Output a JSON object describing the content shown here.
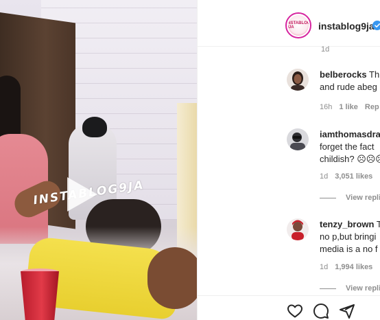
{
  "video": {
    "watermark": "INSTABLOG9JA"
  },
  "post": {
    "username": "instablog9ja",
    "verified_color": "#3897f0",
    "avatar_text": "INSTABLOG 9JA",
    "faded_timestamp": "1d"
  },
  "comments": [
    {
      "username": "belberocks",
      "lines": [
        "This",
        "and rude abeg"
      ],
      "time": "16h",
      "likes": "1 like",
      "reply": "Rep"
    },
    {
      "username": "iamthomasdrab",
      "lines": [
        "",
        "forget the fact",
        "childish? ☹☹☹"
      ],
      "time": "1d",
      "likes": "3,051 likes",
      "view_replies": "View repli"
    },
    {
      "username": "tenzy_brown",
      "lines": [
        "T",
        "no p,but bringi",
        "media is a no f"
      ],
      "time": "1d",
      "likes": "1,994 likes",
      "view_replies": "View repli"
    }
  ],
  "actions": {
    "icons": [
      "heart-icon",
      "comment-icon",
      "share-icon"
    ]
  }
}
